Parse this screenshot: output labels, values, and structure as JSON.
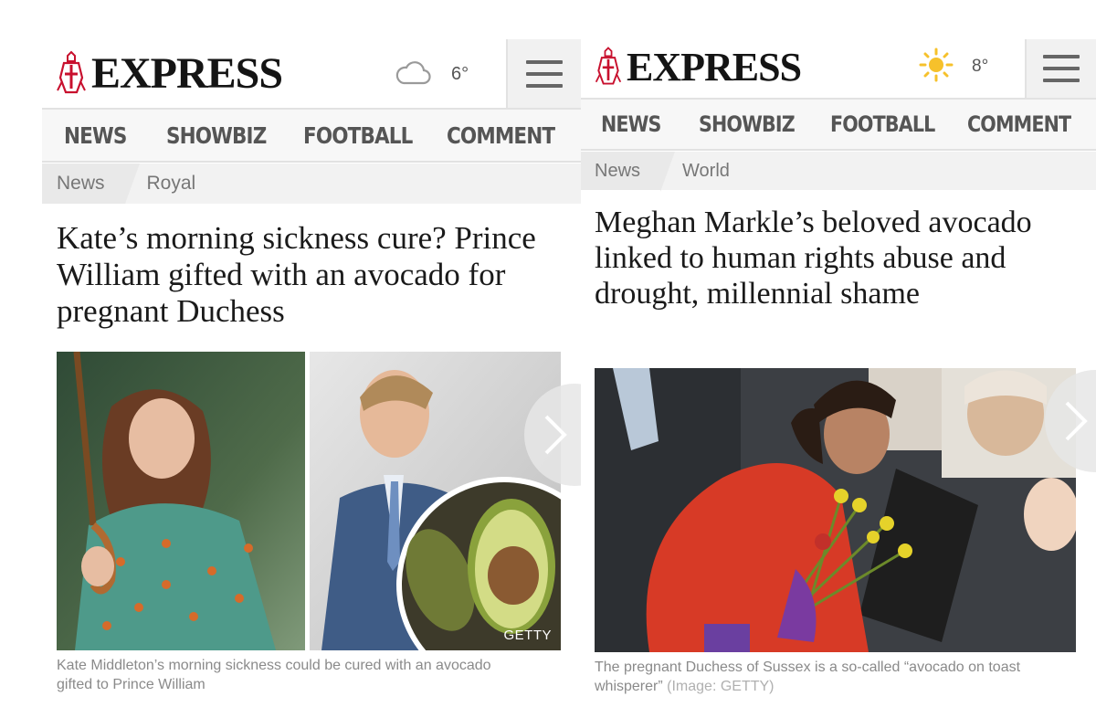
{
  "left": {
    "logo_text": "EXPRESS",
    "weather": {
      "icon": "cloud-icon",
      "temp": "6°"
    },
    "nav": [
      "NEWS",
      "SHOWBIZ",
      "FOOTBALL",
      "COMMENT"
    ],
    "breadcrumb": [
      "News",
      "Royal"
    ],
    "headline": "Kate’s morning sickness cure? Prince William gifted with an avocado for pregnant Duchess",
    "image_credit": "GETTY",
    "caption": "Kate Middleton’s morning sickness could be cured with an avocado gifted to Prince William"
  },
  "right": {
    "logo_text": "EXPRESS",
    "weather": {
      "icon": "sun-icon",
      "temp": "8°"
    },
    "nav": [
      "NEWS",
      "SHOWBIZ",
      "FOOTBALL",
      "COMMENT"
    ],
    "breadcrumb": [
      "News",
      "World"
    ],
    "headline": "Meghan Markle’s beloved avocado linked to human rights abuse and drought, millennial shame",
    "caption": "The pregnant Duchess of Sussex is a so-called “avocado on toast whisperer”",
    "caption_credit": "(Image: GETTY)"
  },
  "colors": {
    "logo_red": "#c8102e",
    "sun": "#f6c12b",
    "nav_text": "#555555"
  }
}
